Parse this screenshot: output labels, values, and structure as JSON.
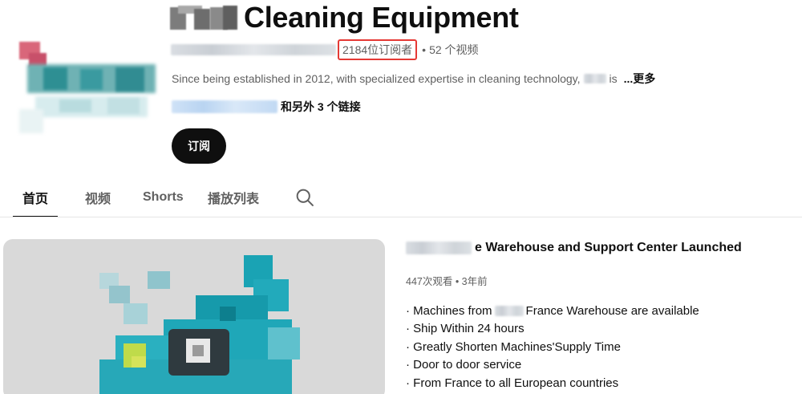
{
  "channel": {
    "title": "Cleaning Equipment",
    "subscribers": "2184位订阅者",
    "separator": "•",
    "video_count": "52 个视频",
    "description": "Since being established in 2012, with specialized expertise in cleaning technology,",
    "description_tail": "is",
    "more_label": "...更多",
    "links_more": "和另外 3 个链接",
    "subscribe_label": "订阅"
  },
  "tabs": [
    {
      "label": "首页",
      "active": true
    },
    {
      "label": "视频",
      "active": false
    },
    {
      "label": "Shorts",
      "active": false
    },
    {
      "label": "播放列表",
      "active": false
    }
  ],
  "featured_video": {
    "title_suffix": "e Warehouse and Support Center Launched",
    "meta": "447次观看 • 3年前",
    "description_lines": [
      "· Machines from",
      "France Warehouse are available",
      "· Ship Within 24 hours",
      "· Greatly Shorten Machines'Supply Time",
      "· Door to door service",
      "· From France to all European countries"
    ]
  },
  "icons": {
    "search": "search-icon",
    "play": "play-icon"
  },
  "colors": {
    "highlight_border": "#e53935",
    "subscribe_bg": "#0f0f0f",
    "thumbnail_accent": "#1aa3b4"
  }
}
